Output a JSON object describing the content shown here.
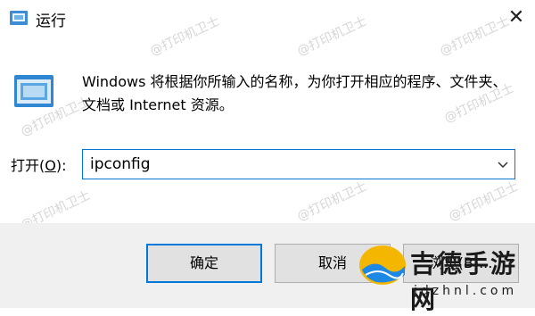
{
  "window": {
    "title": "运行",
    "close_glyph": "✕"
  },
  "description": "Windows 将根据你所输入的名称，为你打开相应的程序、文件夹、文档或 Internet 资源。",
  "open": {
    "label_prefix": "打开(",
    "label_accel": "O",
    "label_suffix": "):",
    "value": "ipconfig"
  },
  "buttons": {
    "ok": "确定",
    "cancel": "取消",
    "browse": "浏览(B)..."
  },
  "watermark": "@打印机卫士",
  "badge": {
    "name": "吉德手游网",
    "url": "jdzhnl.com"
  },
  "icons": {
    "app": "run-app-icon",
    "run": "run-dialog-icon",
    "close": "close-icon",
    "dropdown": "chevron-down-icon",
    "badge": "badge-logo-icon"
  },
  "colors": {
    "accent": "#0078d7",
    "footer_bg": "#f0f0f0",
    "button_bg": "#e1e1e1"
  }
}
